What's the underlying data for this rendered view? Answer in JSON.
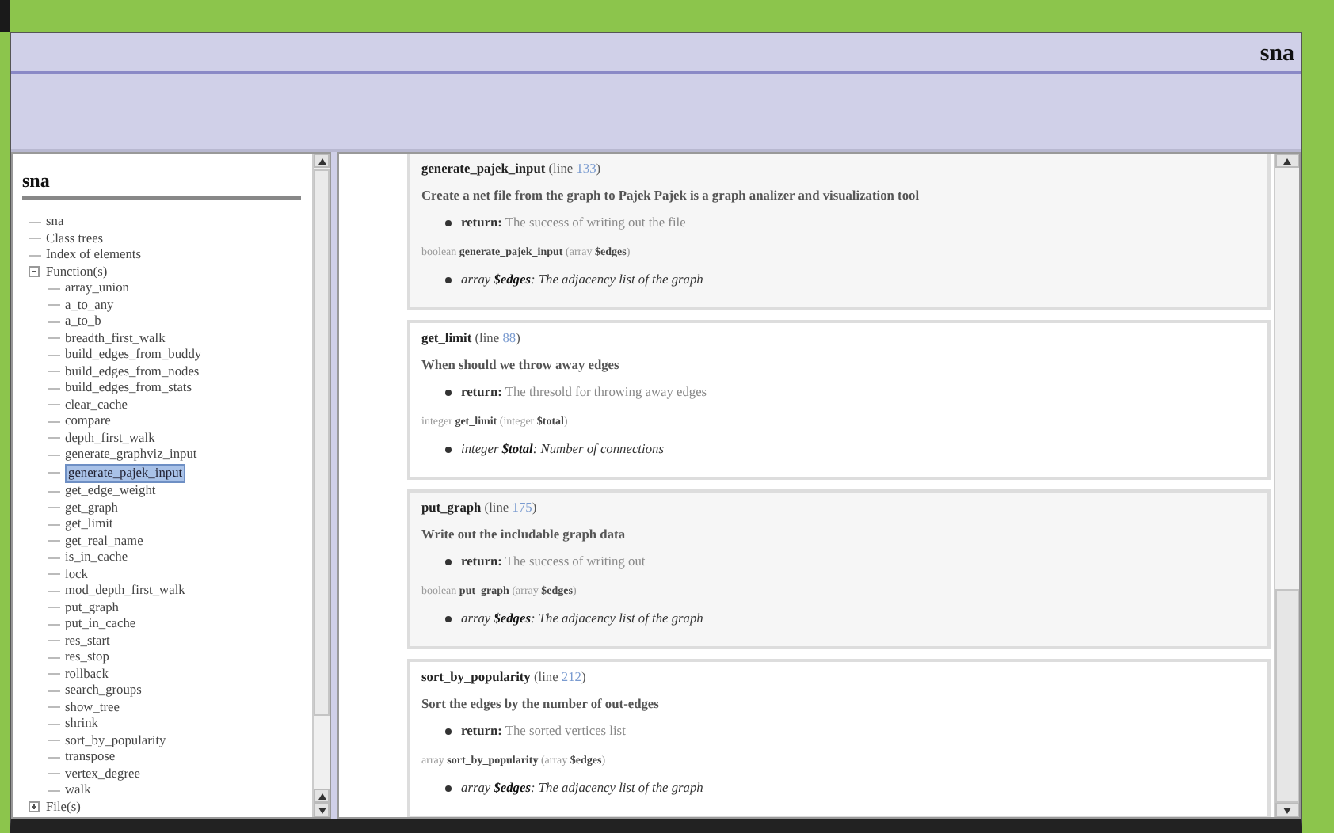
{
  "header": {
    "title": "sna"
  },
  "sidebar": {
    "title": "sna",
    "tree": [
      {
        "label": "sna",
        "kind": "leaf",
        "selected": false
      },
      {
        "label": "Class trees",
        "kind": "leaf",
        "selected": false
      },
      {
        "label": "Index of elements",
        "kind": "leaf",
        "selected": false
      },
      {
        "label": "Function(s)",
        "kind": "folder",
        "expanded": true,
        "selected": false,
        "children": [
          {
            "label": "array_union",
            "kind": "leaf",
            "selected": false
          },
          {
            "label": "a_to_any",
            "kind": "leaf",
            "selected": false
          },
          {
            "label": "a_to_b",
            "kind": "leaf",
            "selected": false
          },
          {
            "label": "breadth_first_walk",
            "kind": "leaf",
            "selected": false
          },
          {
            "label": "build_edges_from_buddy",
            "kind": "leaf",
            "selected": false
          },
          {
            "label": "build_edges_from_nodes",
            "kind": "leaf",
            "selected": false
          },
          {
            "label": "build_edges_from_stats",
            "kind": "leaf",
            "selected": false
          },
          {
            "label": "clear_cache",
            "kind": "leaf",
            "selected": false
          },
          {
            "label": "compare",
            "kind": "leaf",
            "selected": false
          },
          {
            "label": "depth_first_walk",
            "kind": "leaf",
            "selected": false
          },
          {
            "label": "generate_graphviz_input",
            "kind": "leaf",
            "selected": false
          },
          {
            "label": "generate_pajek_input",
            "kind": "leaf",
            "selected": true
          },
          {
            "label": "get_edge_weight",
            "kind": "leaf",
            "selected": false
          },
          {
            "label": "get_graph",
            "kind": "leaf",
            "selected": false
          },
          {
            "label": "get_limit",
            "kind": "leaf",
            "selected": false
          },
          {
            "label": "get_real_name",
            "kind": "leaf",
            "selected": false
          },
          {
            "label": "is_in_cache",
            "kind": "leaf",
            "selected": false
          },
          {
            "label": "lock",
            "kind": "leaf",
            "selected": false
          },
          {
            "label": "mod_depth_first_walk",
            "kind": "leaf",
            "selected": false
          },
          {
            "label": "put_graph",
            "kind": "leaf",
            "selected": false
          },
          {
            "label": "put_in_cache",
            "kind": "leaf",
            "selected": false
          },
          {
            "label": "res_start",
            "kind": "leaf",
            "selected": false
          },
          {
            "label": "res_stop",
            "kind": "leaf",
            "selected": false
          },
          {
            "label": "rollback",
            "kind": "leaf",
            "selected": false
          },
          {
            "label": "search_groups",
            "kind": "leaf",
            "selected": false
          },
          {
            "label": "show_tree",
            "kind": "leaf",
            "selected": false
          },
          {
            "label": "shrink",
            "kind": "leaf",
            "selected": false
          },
          {
            "label": "sort_by_popularity",
            "kind": "leaf",
            "selected": false
          },
          {
            "label": "transpose",
            "kind": "leaf",
            "selected": false
          },
          {
            "label": "vertex_degree",
            "kind": "leaf",
            "selected": false
          },
          {
            "label": "walk",
            "kind": "leaf",
            "selected": false
          }
        ]
      },
      {
        "label": "File(s)",
        "kind": "folder",
        "expanded": false,
        "selected": false
      }
    ]
  },
  "functions": [
    {
      "heading": "**generate_pajek_input** (line ",
      "line": "133",
      "heading_end": ")",
      "description": "Create a net file from the graph to Pajek Pajek is a graph analizer and visualization tool",
      "return": "**return:** The success of writing out the file",
      "signature": "boolean **generate_pajek_input** (array **$edges**)",
      "params": [
        "array **$edges**: The adjacency list of the graph"
      ]
    },
    {
      "heading": "**get_limit** (line ",
      "line": "88",
      "heading_end": ")",
      "description": "When should we throw away edges",
      "return": "**return:** The thresold for throwing away edges",
      "signature": "integer **get_limit** (integer **$total**)",
      "params": [
        "integer **$total**: Number of connections"
      ]
    },
    {
      "heading": "**put_graph** (line ",
      "line": "175",
      "heading_end": ")",
      "description": "Write out the includable graph data",
      "return": "**return:** The success of writing out",
      "signature": "boolean **put_graph** (array **$edges**)",
      "params": [
        "array **$edges**: The adjacency list of the graph"
      ]
    },
    {
      "heading": "**sort_by_popularity** (line ",
      "line": "212",
      "heading_end": ")",
      "description": "Sort the edges by the number of out-edges",
      "return": "**return:** The sorted vertices list",
      "signature": "array **sort_by_popularity** (array **$edges**)",
      "params": [
        "array **$edges**: The adjacency list of the graph"
      ]
    }
  ]
}
